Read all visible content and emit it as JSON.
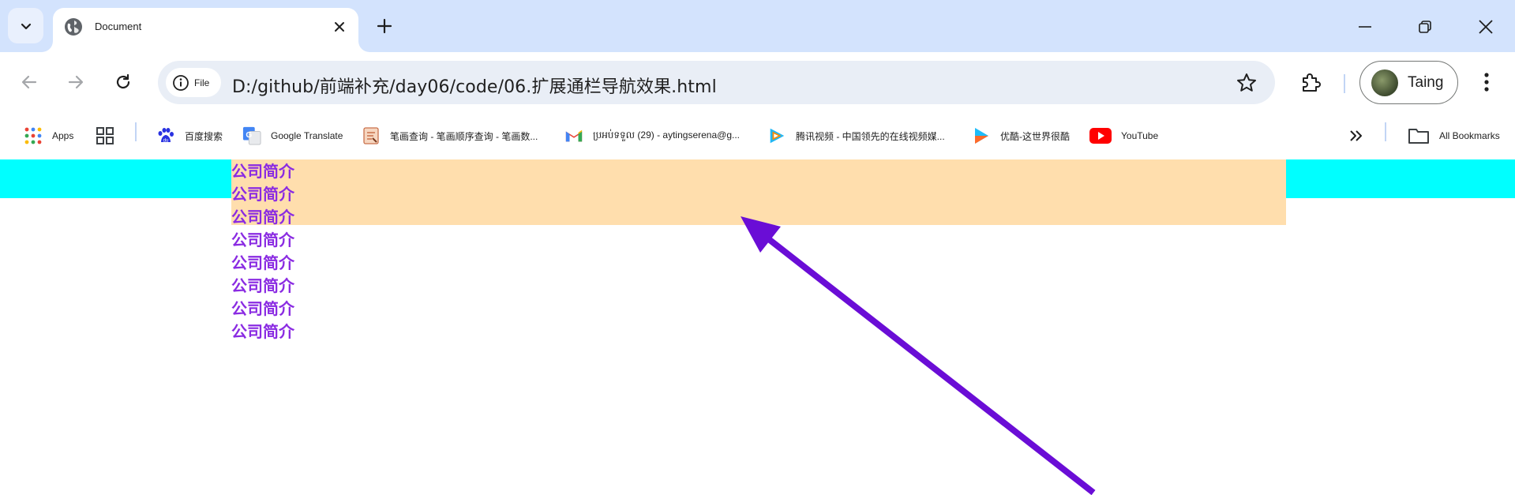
{
  "browser": {
    "tab": {
      "title": "Document",
      "favicon": "globe-icon"
    },
    "address": {
      "chip_label": "File",
      "url": "D:/github/前端补充/day06/code/06.扩展通栏导航效果.html"
    },
    "profile": {
      "name": "Taing"
    }
  },
  "bookmarks": [
    {
      "label": "Apps",
      "icon": "apps-grid-icon"
    },
    {
      "label": "",
      "icon": "tab-groups-icon"
    },
    {
      "label": "百度搜索",
      "icon": "baidu-icon"
    },
    {
      "label": "Google Translate",
      "icon": "google-translate-icon"
    },
    {
      "label": "笔画查询 - 笔画顺序查询 - 笔画数...",
      "icon": "stroke-order-icon"
    },
    {
      "label": "ប្រអប់ទទួល (29) - aytingserena@g...",
      "icon": "gmail-icon"
    },
    {
      "label": "腾讯视频 - 中国领先的在线视频媒...",
      "icon": "tencent-video-icon"
    },
    {
      "label": "优酷-这世界很酷",
      "icon": "youku-icon"
    },
    {
      "label": "YouTube",
      "icon": "youtube-icon"
    },
    {
      "label": "All Bookmarks",
      "icon": "folder-icon"
    }
  ],
  "page": {
    "nav_items": [
      "公司简介",
      "公司简介",
      "公司简介",
      "公司简介",
      "公司简介",
      "公司简介",
      "公司简介",
      "公司简介"
    ]
  },
  "colors": {
    "nav_band": "#00ffff",
    "nav_inner": "#ffdead",
    "nav_text": "#8a2be2",
    "annotation_arrow": "#6a0dd6",
    "tabstrip": "#d3e3fd"
  }
}
